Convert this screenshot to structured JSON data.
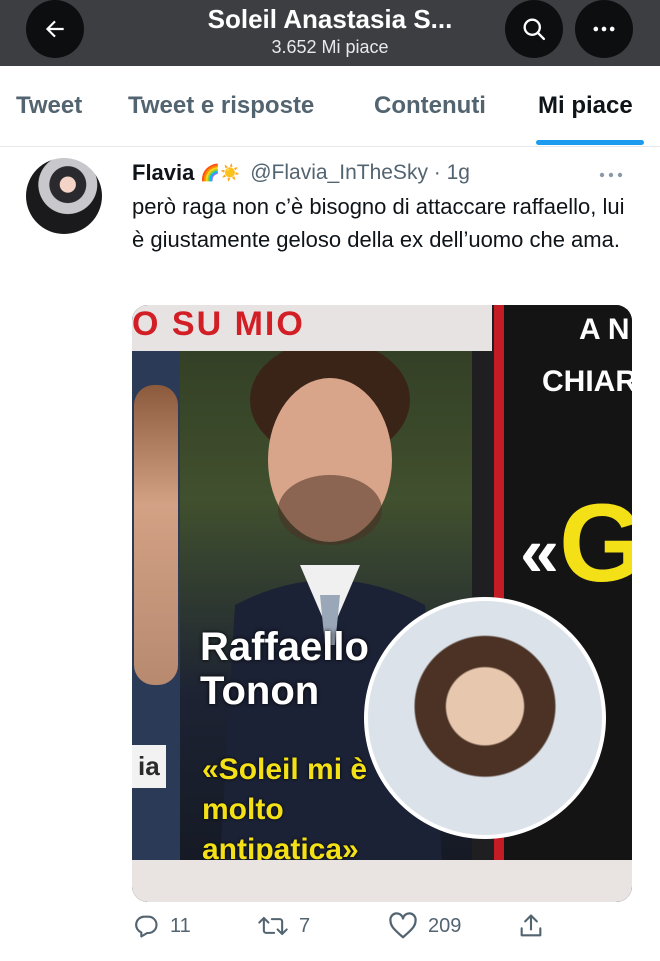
{
  "header": {
    "title": "Soleil Anastasia S...",
    "subtitle": "3.652 Mi piace"
  },
  "tabs": [
    {
      "label": "Tweet",
      "active": false
    },
    {
      "label": "Tweet e risposte",
      "active": false
    },
    {
      "label": "Contenuti",
      "active": false
    },
    {
      "label": "Mi piace",
      "active": true
    }
  ],
  "colors": {
    "header_bg": "#3d3e42",
    "accent": "#1d9bf0",
    "text_primary": "#0f1419",
    "text_secondary": "#536471"
  },
  "tweet": {
    "author_name": "Flavia",
    "author_emojis": "🌈☀️",
    "handle_time": "@Flavia_InTheSky · 1g",
    "text": "però raga non c’è bisogno di attaccare raffaello, lui è giustamente geloso della ex dell’uomo che ama.",
    "media": {
      "headline_top": "O SU MIO",
      "right_top": "A N",
      "right_sub": "CHIAR",
      "right_big": "G",
      "left_caption": "ia",
      "caption_name": "Raffaello Tonon",
      "caption_quote": "«Soleil mi è molto antipatica»"
    },
    "actions": {
      "replies": "11",
      "retweets": "7",
      "likes": "209"
    }
  },
  "icons": {
    "back": "back-arrow-icon",
    "search": "search-icon",
    "more": "more-icon",
    "reply": "reply-icon",
    "retweet": "retweet-icon",
    "like": "heart-icon",
    "share": "share-icon"
  }
}
